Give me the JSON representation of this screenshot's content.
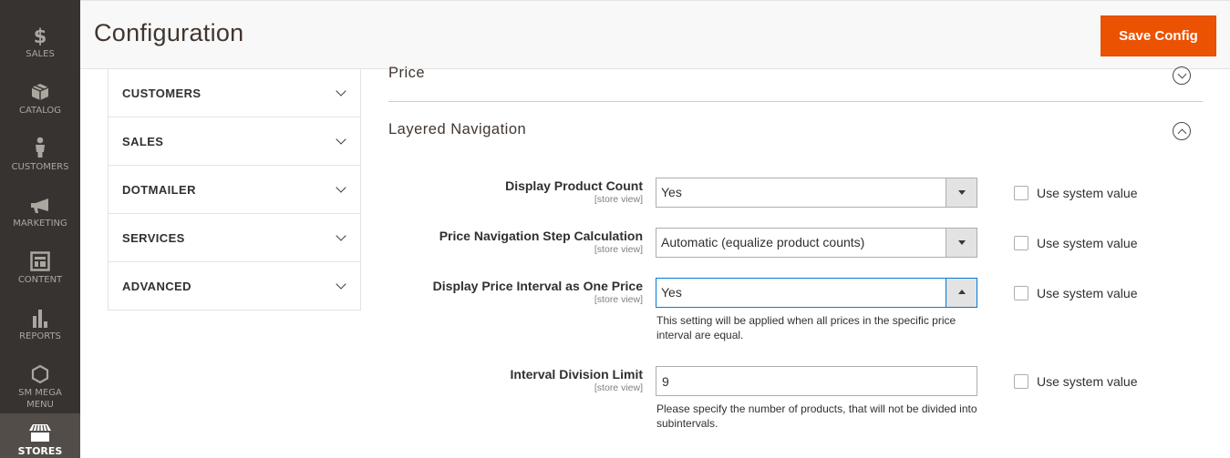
{
  "admin_nav": {
    "items": [
      {
        "label": "SALES",
        "icon": "dollar-icon"
      },
      {
        "label": "CATALOG",
        "icon": "box-icon"
      },
      {
        "label": "CUSTOMERS",
        "icon": "person-icon"
      },
      {
        "label": "MARKETING",
        "icon": "megaphone-icon"
      },
      {
        "label": "CONTENT",
        "icon": "layout-icon"
      },
      {
        "label": "REPORTS",
        "icon": "bar-chart-icon"
      },
      {
        "label": "SM MEGA MENU",
        "icon": "hexagon-icon"
      },
      {
        "label": "STORES",
        "icon": "storefront-icon",
        "active": true
      }
    ]
  },
  "header": {
    "title": "Configuration",
    "save_label": "Save Config"
  },
  "config_tabs": [
    {
      "label": "CUSTOMERS"
    },
    {
      "label": "SALES"
    },
    {
      "label": "DOTMAILER"
    },
    {
      "label": "SERVICES"
    },
    {
      "label": "ADVANCED"
    }
  ],
  "sections": {
    "price": {
      "title": "Price",
      "state": "collapsed"
    },
    "layered_navigation": {
      "title": "Layered Navigation",
      "state": "expanded"
    }
  },
  "fields": [
    {
      "label": "Display Product Count",
      "scope": "[store view]",
      "type": "select",
      "value": "Yes",
      "use_system_value": false
    },
    {
      "label": "Price Navigation Step Calculation",
      "scope": "[store view]",
      "type": "select",
      "value": "Automatic (equalize product counts)",
      "use_system_value": false
    },
    {
      "label": "Display Price Interval as One Price",
      "scope": "[store view]",
      "type": "select",
      "value": "Yes",
      "open": true,
      "note": "This setting will be applied when all prices in the specific price interval are equal.",
      "use_system_value": false
    },
    {
      "label": "Interval Division Limit",
      "scope": "[store view]",
      "type": "text",
      "value": "9",
      "note": "Please specify the number of products, that will not be divided into subintervals.",
      "use_system_value": false
    }
  ],
  "system_value_label": "Use system value",
  "colors": {
    "nav_bg": "#373330",
    "nav_active_bg": "#524d49",
    "accent": "#eb5202",
    "focus": "#007bdb"
  }
}
